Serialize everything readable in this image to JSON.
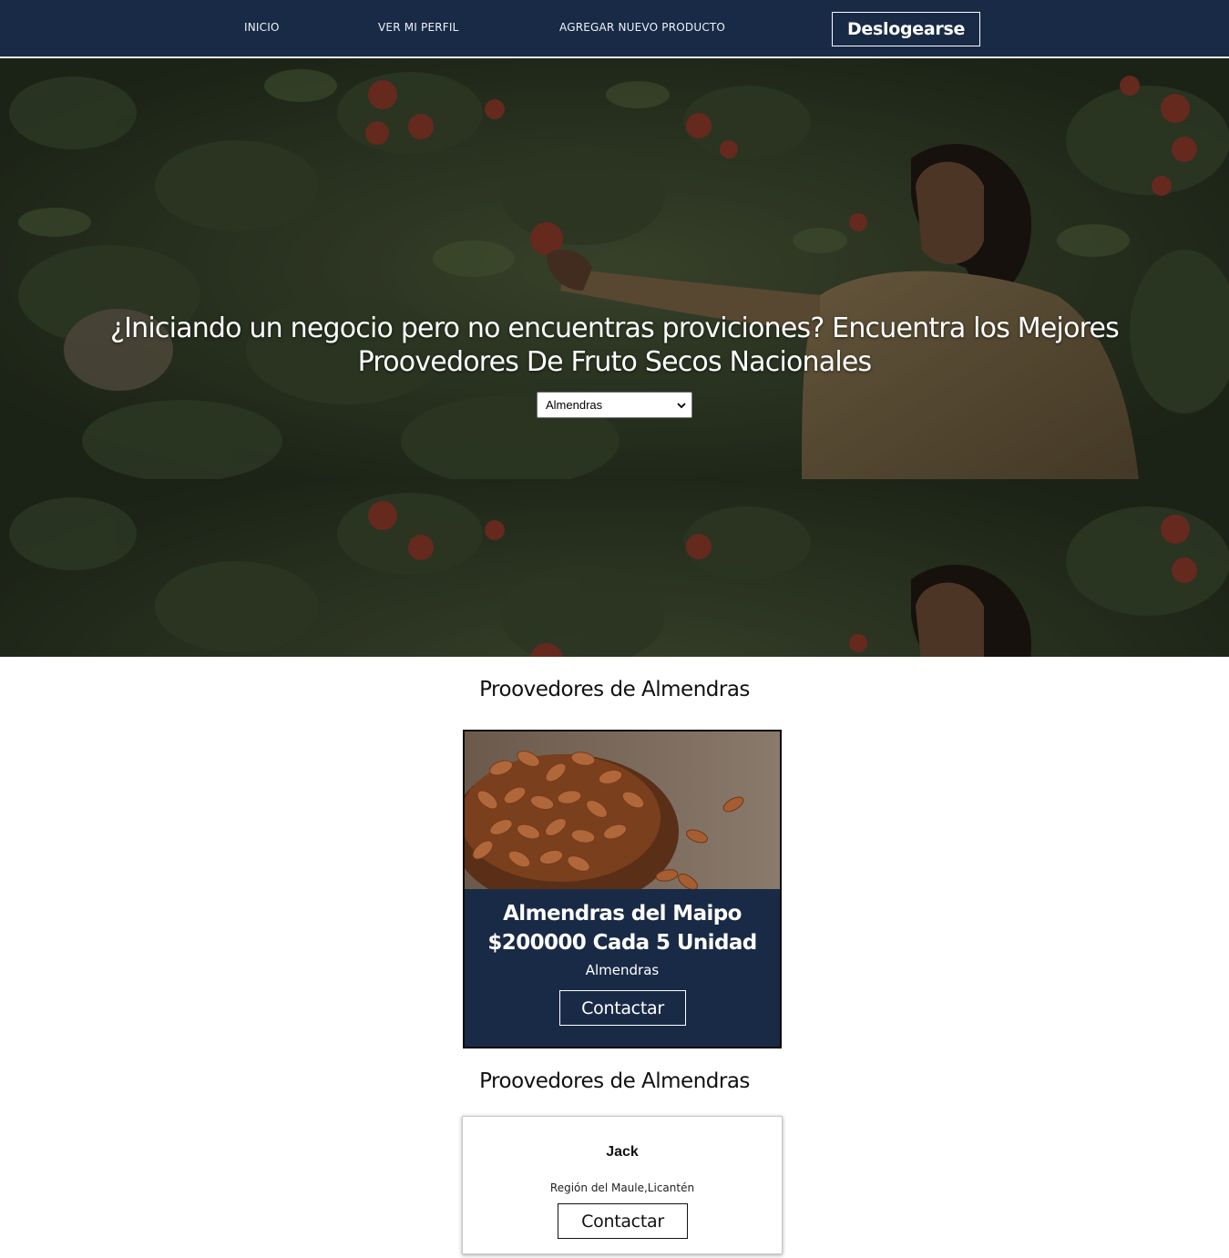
{
  "nav": {
    "items": [
      {
        "label": "INICIO"
      },
      {
        "label": "VER MI PERFIL"
      },
      {
        "label": "AGREGAR NUEVO PRODUCTO"
      }
    ],
    "logout_label": "Deslogearse"
  },
  "hero": {
    "title": "¿Iniciando un negocio pero no encuentras proviciones? Encuentra los Mejores Proovedores De Fruto Secos Nacionales",
    "select_value": "Almendras"
  },
  "products_section": {
    "title": "Proovedores de Almendras",
    "products": [
      {
        "name": "Almendras del Maipo",
        "price": "$200000 Cada 5 Unidad",
        "category": "Almendras",
        "contact_label": "Contactar"
      }
    ]
  },
  "suppliers_section": {
    "title": "Proovedores de Almendras",
    "suppliers": [
      {
        "name": "Jack",
        "region": "Región del Maule,Licantén",
        "contact_label": "Contactar"
      }
    ]
  },
  "colors": {
    "navy": "#192a46",
    "white": "#ffffff"
  }
}
